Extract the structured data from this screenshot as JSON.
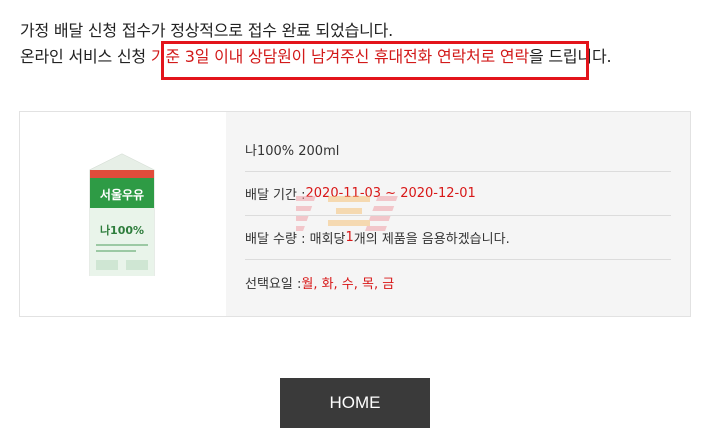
{
  "notice": {
    "line1": "가정 배달 신청 접수가 정상적으로 접수 완료 되었습니다.",
    "line2_pre": "온라인 서비스 신청 ",
    "line2_highlight": "기준 3일 이내 상담원이 남겨주신 휴대전화 연락처로 연락",
    "line2_post": "을 드립니다."
  },
  "product": {
    "name": "나100% 200ml",
    "period_label": "배달 기간 : ",
    "period_value": "2020-11-03 ~ 2020-12-01",
    "qty_label": "배달 수량 : 매회당 ",
    "qty_value": "1",
    "qty_suffix": "개의 제품을 음용하겠습니다.",
    "days_label": "선택요일 : ",
    "days_value": "월, 화, 수, 목, 금",
    "carton_brand": "서울우유",
    "carton_product": "나100%"
  },
  "home_button": {
    "label": "HOME"
  },
  "colors": {
    "highlight": "#d21a1a",
    "box": "#e3141b",
    "button_bg": "#3a3a3a",
    "carton_green": "#3aa04a"
  }
}
